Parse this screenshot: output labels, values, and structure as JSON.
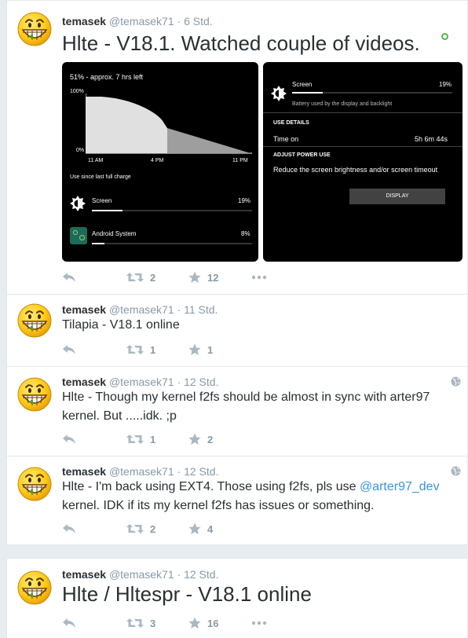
{
  "tweets": [
    {
      "name": "temasek",
      "handle": "@temasek71",
      "dot": "·",
      "time": "6 Std.",
      "text": "Hlte - V18.1. Watched couple of videos.",
      "retweets": "2",
      "likes": "12",
      "media": {
        "left": {
          "battery_status": "51% - approx. 7 hrs left",
          "y_max": "100%",
          "y_min": "0%",
          "x_ticks": [
            "11 AM",
            "4 PM",
            "11 PM"
          ],
          "since_label": "Use since last full charge",
          "usage": [
            {
              "label": "Screen",
              "percent": "19%",
              "fraction": 0.19
            },
            {
              "label": "Android System",
              "percent": "8%",
              "fraction": 0.08
            }
          ]
        },
        "right": {
          "title": "Screen",
          "percent": "19%",
          "fraction": 0.19,
          "subtitle": "Battery used by the display and backlight",
          "use_details": "USE DETAILS",
          "time_on_label": "Time on",
          "time_on_value": "5h 6m 44s",
          "adjust_header": "ADJUST POWER USE",
          "adjust_text": "Reduce the screen brightness and/or screen timeout",
          "button": "DISPLAY"
        }
      }
    },
    {
      "name": "temasek",
      "handle": "@temasek71",
      "dot": "·",
      "time": "11 Std.",
      "text": "Tilapia - V18.1 online",
      "retweets": "1",
      "likes": "1"
    },
    {
      "name": "temasek",
      "handle": "@temasek71",
      "dot": "·",
      "time": "12 Std.",
      "text": "Hlte - Though my kernel f2fs should be almost in sync with arter97 kernel. But .....idk. ;p",
      "retweets": "1",
      "likes": "2"
    },
    {
      "name": "temasek",
      "handle": "@temasek71",
      "dot": "·",
      "time": "12 Std.",
      "text_before": "Hlte - I'm back using EXT4. Those using f2fs, pls use",
      "mention": "@arter97_dev",
      "text_after": "kernel. IDK if its my kernel f2fs has issues or something.",
      "retweets": "2",
      "likes": "4"
    },
    {
      "name": "temasek",
      "handle": "@temasek71",
      "dot": "·",
      "time": "12 Std.",
      "text": "Hlte / Hltespr - V18.1 online",
      "retweets": "3",
      "likes": "16"
    }
  ],
  "icons": {
    "avatar": "grinning-face-avatar",
    "reply": "reply-icon",
    "retweet": "retweet-icon",
    "like": "star-icon",
    "more": "more-dots-icon",
    "location": "globe-icon"
  },
  "colors": {
    "text": "#292f33",
    "muted": "#8899a6",
    "link": "#3b94d9",
    "divider": "#e1e8ed",
    "background": "#e6ecf0"
  }
}
